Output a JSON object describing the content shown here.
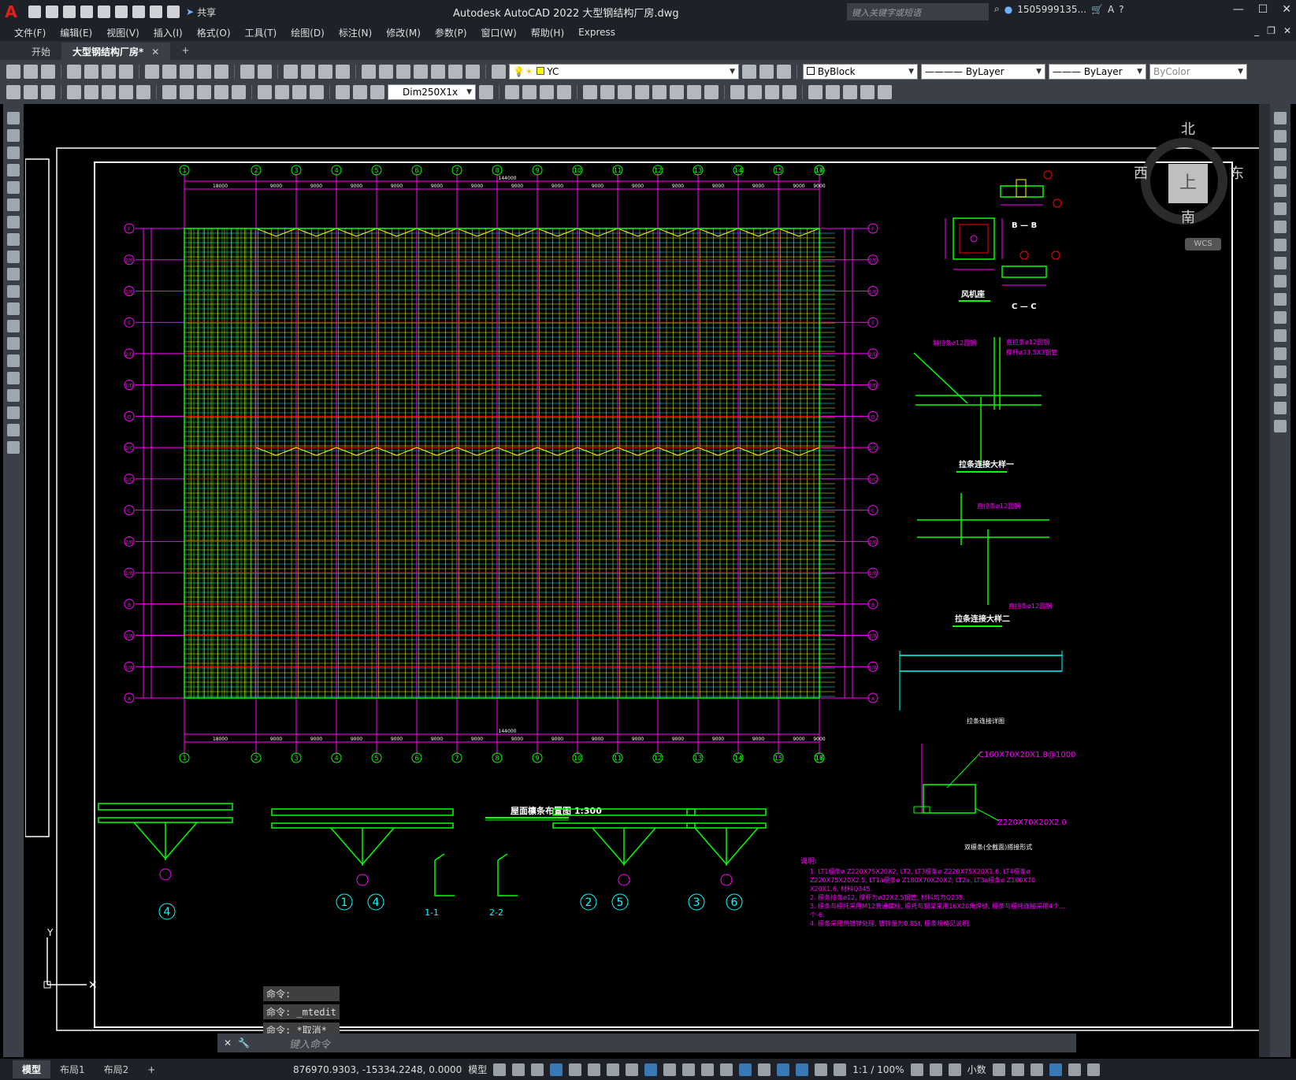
{
  "window": {
    "app_letter": "A",
    "title": "Autodesk AutoCAD 2022    大型钢结构厂房.dwg",
    "share_label": "共享",
    "search_placeholder": "键入关键字或短语",
    "user": "1505999135...",
    "help": "?"
  },
  "menu": [
    "文件(F)",
    "编辑(E)",
    "视图(V)",
    "插入(I)",
    "格式(O)",
    "工具(T)",
    "绘图(D)",
    "标注(N)",
    "修改(M)",
    "参数(P)",
    "窗口(W)",
    "帮助(H)",
    "Express"
  ],
  "tabs": {
    "start": "开始",
    "active": "大型钢结构厂房*",
    "close": "✕",
    "add": "+"
  },
  "toolbar": {
    "layer_combo": "YC",
    "color_combo": "ByBlock",
    "linetype_combo": "ByLayer",
    "lineweight_combo": "ByLayer",
    "plotstyle_combo": "ByColor",
    "dimstyle_combo": "Dim250X1x"
  },
  "viewcube": {
    "north": "北",
    "south": "南",
    "east": "东",
    "west": "西",
    "top_face": "上",
    "wcs": "WCS"
  },
  "drawing": {
    "main_title": "屋面檩条布置图 1:300",
    "col_axes": [
      "1",
      "2",
      "3",
      "4",
      "5",
      "6",
      "7",
      "8",
      "9",
      "10",
      "11",
      "12",
      "13",
      "14",
      "15",
      "16",
      "17"
    ],
    "row_axes": [
      "F",
      "2/E",
      "1/E",
      "E",
      "2/D",
      "1/D",
      "D",
      "2/C",
      "1/C",
      "C",
      "2/B",
      "1/B",
      "B",
      "2/A",
      "1/A",
      "A"
    ],
    "top_total": "144000",
    "top_first": "18000",
    "span": "9000",
    "section_a_title": "风机座",
    "section_b_label": "B — B",
    "section_c_label": "C — C",
    "detail1_title": "拉条连接大样一",
    "detail2_title": "拉条连接大样二",
    "detail3_title": "拉条连接详图",
    "purlin_top": "C160X70X20X1.8@1000",
    "purlin_bottom": "Z220X70X20X2.0",
    "purlin_note": "双檩条(全截面)搭接形式",
    "tie_label_1": "斜拉条ø12圆钢",
    "tie_label_2": "直拉条ø12圆钢",
    "tie_label_3": "撑杆ø33.5X3钢管",
    "bottom_labels": [
      "4",
      "1",
      "4",
      "1-1",
      "2-2",
      "2",
      "5",
      "3",
      "6"
    ],
    "notes_title": "说明:",
    "notes": [
      "1. LT1檩条ø Z220X75X20X2, LT2, LT3檩条ø Z220X75X20X1.6, LT4檩条ø",
      "   Z220X75X20X2.5, LT1a檩条ø Z180X70X20X2, LT2a, LT3a檩条ø Z180X70",
      "   X20X1.6, 材料Q345.",
      "2. 檩条拉条ø12, 撑杆为ø32X2.5钢管, 材料均为Q235.",
      "3. 檩条与檩托采用M12普通螺栓, 檩托与钢梁采用16X20角焊缝, 檩条与檩托连接采用4个...",
      "   个-6.",
      "4. 檩条采用热镀锌处理, 镀锌量为0.85t, 檩条规格见说明."
    ]
  },
  "command": {
    "history": [
      "命令:",
      "命令: _mtedit",
      "命令: *取消*"
    ],
    "placeholder": "键入命令"
  },
  "layouts": [
    "模型",
    "布局1",
    "布局2",
    "+"
  ],
  "status": {
    "coords": "876970.9303, -15334.2248, 0.0000",
    "space": "模型",
    "scale": "1:1 / 100%",
    "units": "小数"
  },
  "colors": {
    "axis": "#ff00ff",
    "purlin": "#ffff00",
    "green": "#00ff00",
    "cyan": "#00ffff",
    "red": "#ff0000",
    "frame": "#ffffff"
  }
}
